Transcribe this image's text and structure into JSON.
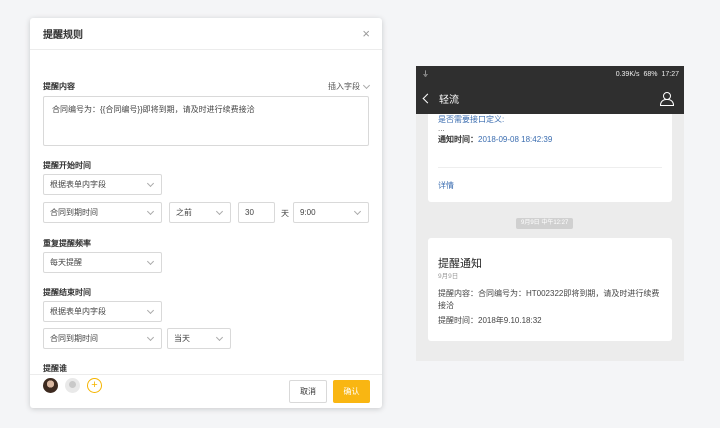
{
  "dialog": {
    "title": "提醒规则",
    "close_glyph": "×",
    "content_label": "提醒内容",
    "insert_field": "插入字段",
    "content_text": "合同编号为：{{合同编号}}即将到期，请及时进行续费接洽",
    "start_label": "提醒开始时间",
    "start_source": "根据表单内字段",
    "start_field": "合同到期时间",
    "start_relation": "之前",
    "start_offset": "30",
    "start_unit": "天",
    "start_time": "9:00",
    "freq_label": "重复提醒频率",
    "freq_value": "每天提醒",
    "end_label": "提醒结束时间",
    "end_source": "根据表单内字段",
    "end_field": "合同到期时间",
    "end_relation": "当天",
    "who_label": "提醒谁",
    "add_glyph": "+",
    "cancel_label": "取消",
    "ok_label": "确认"
  },
  "phone": {
    "status_left": "⏚",
    "status_speed": "0.39K/s",
    "status_battery": "68%",
    "status_time": "17:27",
    "nav_title": "轻流",
    "card1": {
      "question": "是否需要接口定义:",
      "dots": "...",
      "notify_label": "通知时间：",
      "notify_value": "2018-09-08 18:42:39",
      "details": "详情"
    },
    "time_pill": "9月9日 中午12:27",
    "card2": {
      "title": "提醒通知",
      "date": "9月9日",
      "content": "提醒内容：合同编号为：HT002322即将到期，请及时进行续费接洽",
      "time": "提醒时间：2018年9.10.18:32"
    }
  },
  "colors": {
    "accent": "#f9b612",
    "link": "#3b6db0",
    "dark_bar": "#2f2f2f"
  }
}
